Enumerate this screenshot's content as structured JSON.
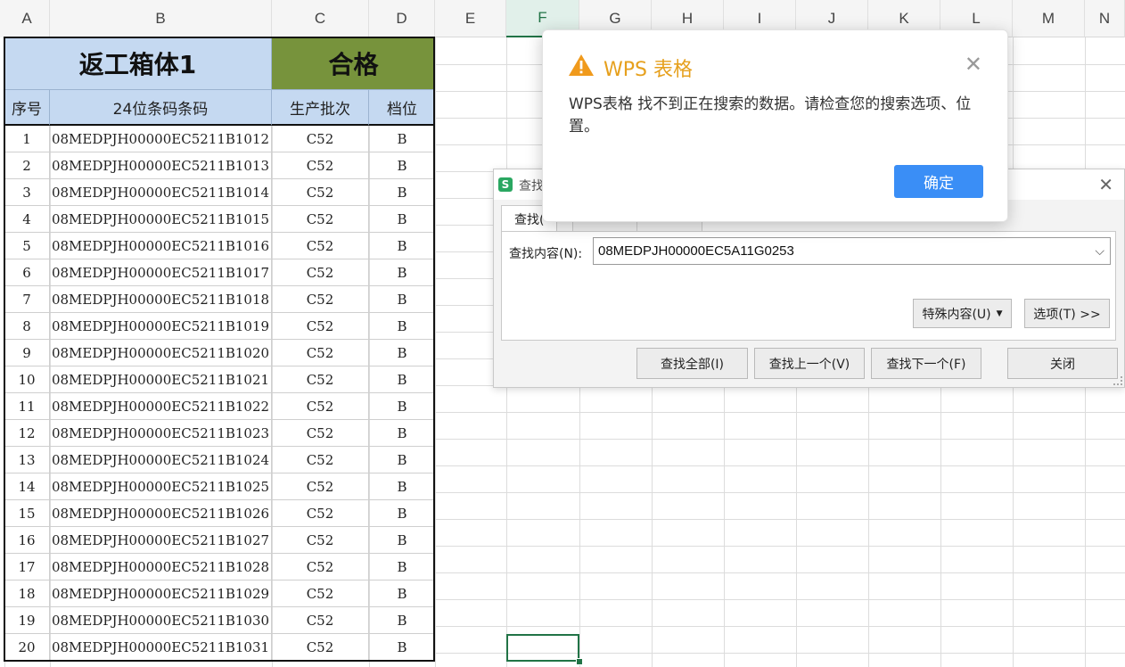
{
  "columns": [
    "A",
    "B",
    "C",
    "D",
    "E",
    "F",
    "G",
    "H",
    "I",
    "J",
    "K",
    "L",
    "M",
    "N"
  ],
  "selected_column": "F",
  "sheet": {
    "title": "返工箱体1",
    "status": "合格",
    "headers": [
      "序号",
      "24位条码条码",
      "生产批次",
      "档位"
    ],
    "rows": [
      {
        "no": "1",
        "code": "08MEDPJH00000EC5211B1012",
        "batch": "C52",
        "grade": "B"
      },
      {
        "no": "2",
        "code": "08MEDPJH00000EC5211B1013",
        "batch": "C52",
        "grade": "B"
      },
      {
        "no": "3",
        "code": "08MEDPJH00000EC5211B1014",
        "batch": "C52",
        "grade": "B"
      },
      {
        "no": "4",
        "code": "08MEDPJH00000EC5211B1015",
        "batch": "C52",
        "grade": "B"
      },
      {
        "no": "5",
        "code": "08MEDPJH00000EC5211B1016",
        "batch": "C52",
        "grade": "B"
      },
      {
        "no": "6",
        "code": "08MEDPJH00000EC5211B1017",
        "batch": "C52",
        "grade": "B"
      },
      {
        "no": "7",
        "code": "08MEDPJH00000EC5211B1018",
        "batch": "C52",
        "grade": "B"
      },
      {
        "no": "8",
        "code": "08MEDPJH00000EC5211B1019",
        "batch": "C52",
        "grade": "B"
      },
      {
        "no": "9",
        "code": "08MEDPJH00000EC5211B1020",
        "batch": "C52",
        "grade": "B"
      },
      {
        "no": "10",
        "code": "08MEDPJH00000EC5211B1021",
        "batch": "C52",
        "grade": "B"
      },
      {
        "no": "11",
        "code": "08MEDPJH00000EC5211B1022",
        "batch": "C52",
        "grade": "B"
      },
      {
        "no": "12",
        "code": "08MEDPJH00000EC5211B1023",
        "batch": "C52",
        "grade": "B"
      },
      {
        "no": "13",
        "code": "08MEDPJH00000EC5211B1024",
        "batch": "C52",
        "grade": "B"
      },
      {
        "no": "14",
        "code": "08MEDPJH00000EC5211B1025",
        "batch": "C52",
        "grade": "B"
      },
      {
        "no": "15",
        "code": "08MEDPJH00000EC5211B1026",
        "batch": "C52",
        "grade": "B"
      },
      {
        "no": "16",
        "code": "08MEDPJH00000EC5211B1027",
        "batch": "C52",
        "grade": "B"
      },
      {
        "no": "17",
        "code": "08MEDPJH00000EC5211B1028",
        "batch": "C52",
        "grade": "B"
      },
      {
        "no": "18",
        "code": "08MEDPJH00000EC5211B1029",
        "batch": "C52",
        "grade": "B"
      },
      {
        "no": "19",
        "code": "08MEDPJH00000EC5211B1030",
        "batch": "C52",
        "grade": "B"
      },
      {
        "no": "20",
        "code": "08MEDPJH00000EC5211B1031",
        "batch": "C52",
        "grade": "B"
      }
    ]
  },
  "find_dialog": {
    "app_icon": "S",
    "title": "查找",
    "tabs": [
      "查找(",
      "",
      ""
    ],
    "search_label": "查找内容(N):",
    "search_value": "08MEDPJH00000EC5A11G0253",
    "special_button": "特殊内容(U)",
    "options_button": "选项(T) >>",
    "find_all_button": "查找全部(I)",
    "find_prev_button": "查找上一个(V)",
    "find_next_button": "查找下一个(F)",
    "close_button": "关闭"
  },
  "alert": {
    "title": "WPS 表格",
    "message": "WPS表格 找不到正在搜索的数据。请检查您的搜索选项、位置。",
    "ok_button": "确定"
  },
  "colors": {
    "title_bg": "#c5d9f1",
    "status_bg": "#77933c",
    "accent_green": "#217346",
    "alert_title": "#e6a01d",
    "ok_button": "#3a8ef6"
  }
}
